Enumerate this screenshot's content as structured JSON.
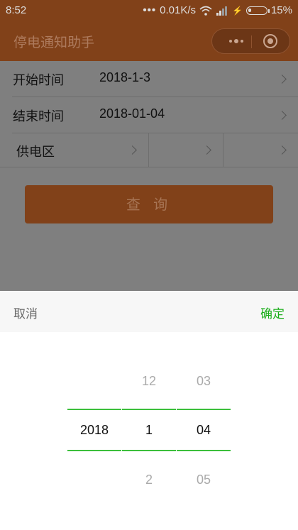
{
  "status_bar": {
    "time": "8:52",
    "network_speed": "0.01K/s",
    "battery_percent": "15%",
    "battery_level": 0.15
  },
  "nav": {
    "title": "停电通知助手"
  },
  "form": {
    "start_label": "开始时间",
    "start_value": "2018-1-3",
    "end_label": "结束时间",
    "end_value": "2018-01-04",
    "area_label": "供电区"
  },
  "query_button": "查 询",
  "picker": {
    "cancel_label": "取消",
    "confirm_label": "确定",
    "year": {
      "selected": "2018"
    },
    "month": {
      "prev": "12",
      "selected": "1",
      "next": "2"
    },
    "day": {
      "prev": "03",
      "selected": "04",
      "next": "05"
    }
  },
  "colors": {
    "brand": "#814119",
    "confirm": "#1aad19",
    "picker_line": "#3cbf3c"
  }
}
